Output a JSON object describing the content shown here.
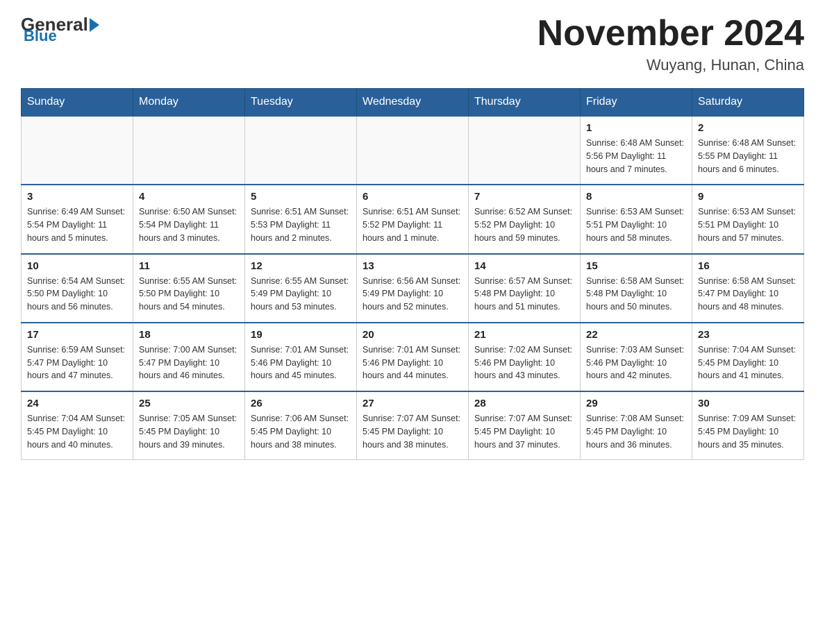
{
  "logo": {
    "general": "General",
    "blue": "Blue",
    "sub": "Blue"
  },
  "title": {
    "month": "November 2024",
    "location": "Wuyang, Hunan, China"
  },
  "days_of_week": [
    "Sunday",
    "Monday",
    "Tuesday",
    "Wednesday",
    "Thursday",
    "Friday",
    "Saturday"
  ],
  "weeks": [
    [
      {
        "day": "",
        "info": ""
      },
      {
        "day": "",
        "info": ""
      },
      {
        "day": "",
        "info": ""
      },
      {
        "day": "",
        "info": ""
      },
      {
        "day": "",
        "info": ""
      },
      {
        "day": "1",
        "info": "Sunrise: 6:48 AM\nSunset: 5:56 PM\nDaylight: 11 hours and 7 minutes."
      },
      {
        "day": "2",
        "info": "Sunrise: 6:48 AM\nSunset: 5:55 PM\nDaylight: 11 hours and 6 minutes."
      }
    ],
    [
      {
        "day": "3",
        "info": "Sunrise: 6:49 AM\nSunset: 5:54 PM\nDaylight: 11 hours and 5 minutes."
      },
      {
        "day": "4",
        "info": "Sunrise: 6:50 AM\nSunset: 5:54 PM\nDaylight: 11 hours and 3 minutes."
      },
      {
        "day": "5",
        "info": "Sunrise: 6:51 AM\nSunset: 5:53 PM\nDaylight: 11 hours and 2 minutes."
      },
      {
        "day": "6",
        "info": "Sunrise: 6:51 AM\nSunset: 5:52 PM\nDaylight: 11 hours and 1 minute."
      },
      {
        "day": "7",
        "info": "Sunrise: 6:52 AM\nSunset: 5:52 PM\nDaylight: 10 hours and 59 minutes."
      },
      {
        "day": "8",
        "info": "Sunrise: 6:53 AM\nSunset: 5:51 PM\nDaylight: 10 hours and 58 minutes."
      },
      {
        "day": "9",
        "info": "Sunrise: 6:53 AM\nSunset: 5:51 PM\nDaylight: 10 hours and 57 minutes."
      }
    ],
    [
      {
        "day": "10",
        "info": "Sunrise: 6:54 AM\nSunset: 5:50 PM\nDaylight: 10 hours and 56 minutes."
      },
      {
        "day": "11",
        "info": "Sunrise: 6:55 AM\nSunset: 5:50 PM\nDaylight: 10 hours and 54 minutes."
      },
      {
        "day": "12",
        "info": "Sunrise: 6:55 AM\nSunset: 5:49 PM\nDaylight: 10 hours and 53 minutes."
      },
      {
        "day": "13",
        "info": "Sunrise: 6:56 AM\nSunset: 5:49 PM\nDaylight: 10 hours and 52 minutes."
      },
      {
        "day": "14",
        "info": "Sunrise: 6:57 AM\nSunset: 5:48 PM\nDaylight: 10 hours and 51 minutes."
      },
      {
        "day": "15",
        "info": "Sunrise: 6:58 AM\nSunset: 5:48 PM\nDaylight: 10 hours and 50 minutes."
      },
      {
        "day": "16",
        "info": "Sunrise: 6:58 AM\nSunset: 5:47 PM\nDaylight: 10 hours and 48 minutes."
      }
    ],
    [
      {
        "day": "17",
        "info": "Sunrise: 6:59 AM\nSunset: 5:47 PM\nDaylight: 10 hours and 47 minutes."
      },
      {
        "day": "18",
        "info": "Sunrise: 7:00 AM\nSunset: 5:47 PM\nDaylight: 10 hours and 46 minutes."
      },
      {
        "day": "19",
        "info": "Sunrise: 7:01 AM\nSunset: 5:46 PM\nDaylight: 10 hours and 45 minutes."
      },
      {
        "day": "20",
        "info": "Sunrise: 7:01 AM\nSunset: 5:46 PM\nDaylight: 10 hours and 44 minutes."
      },
      {
        "day": "21",
        "info": "Sunrise: 7:02 AM\nSunset: 5:46 PM\nDaylight: 10 hours and 43 minutes."
      },
      {
        "day": "22",
        "info": "Sunrise: 7:03 AM\nSunset: 5:46 PM\nDaylight: 10 hours and 42 minutes."
      },
      {
        "day": "23",
        "info": "Sunrise: 7:04 AM\nSunset: 5:45 PM\nDaylight: 10 hours and 41 minutes."
      }
    ],
    [
      {
        "day": "24",
        "info": "Sunrise: 7:04 AM\nSunset: 5:45 PM\nDaylight: 10 hours and 40 minutes."
      },
      {
        "day": "25",
        "info": "Sunrise: 7:05 AM\nSunset: 5:45 PM\nDaylight: 10 hours and 39 minutes."
      },
      {
        "day": "26",
        "info": "Sunrise: 7:06 AM\nSunset: 5:45 PM\nDaylight: 10 hours and 38 minutes."
      },
      {
        "day": "27",
        "info": "Sunrise: 7:07 AM\nSunset: 5:45 PM\nDaylight: 10 hours and 38 minutes."
      },
      {
        "day": "28",
        "info": "Sunrise: 7:07 AM\nSunset: 5:45 PM\nDaylight: 10 hours and 37 minutes."
      },
      {
        "day": "29",
        "info": "Sunrise: 7:08 AM\nSunset: 5:45 PM\nDaylight: 10 hours and 36 minutes."
      },
      {
        "day": "30",
        "info": "Sunrise: 7:09 AM\nSunset: 5:45 PM\nDaylight: 10 hours and 35 minutes."
      }
    ]
  ]
}
